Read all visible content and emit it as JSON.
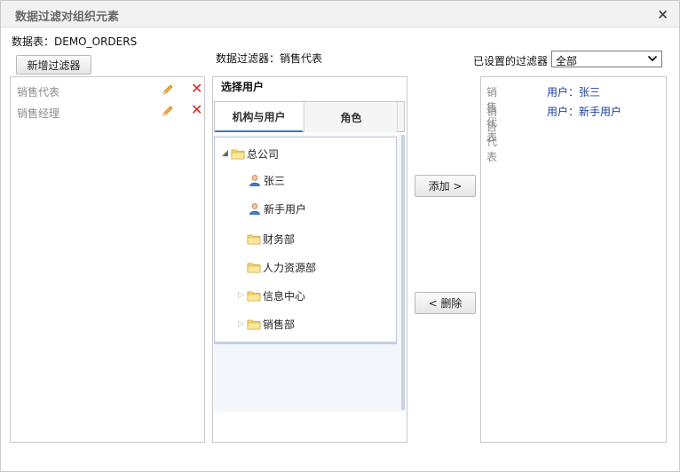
{
  "dialog": {
    "title": "数据过滤对组织元素",
    "close_label": "×",
    "table_label": "数据表：DEMO_ORDERS"
  },
  "left": {
    "new_button": "新增过滤器",
    "filters": [
      {
        "label": "销售代表",
        "edit_icon": "pencil-icon",
        "delete_icon": "delete-icon"
      },
      {
        "label": "销售经理",
        "edit_icon": "pencil-icon",
        "delete_icon": "delete-icon"
      }
    ]
  },
  "middle": {
    "filter_caption": "数据过滤器：销售代表",
    "header": "选择用户",
    "tabs": [
      "机构与用户",
      "角色"
    ],
    "tree": {
      "root": "总公司",
      "users": [
        "张三",
        "新手用户"
      ],
      "departments": [
        "财务部",
        "人力资源部",
        "信息中心",
        "销售部"
      ]
    }
  },
  "actions": {
    "add": "添加 >",
    "remove": "< 删除"
  },
  "right": {
    "caption": "已设置的过滤器",
    "select_value": "全部",
    "rows": [
      {
        "type": "销售代表",
        "member": "用户：张三"
      },
      {
        "type": "销售代表",
        "member": "用户：新手用户"
      }
    ]
  },
  "colors": {
    "link_blue": "#1a3f9c",
    "delete_red": "#e02020",
    "tab_active": "#3a78c3"
  }
}
